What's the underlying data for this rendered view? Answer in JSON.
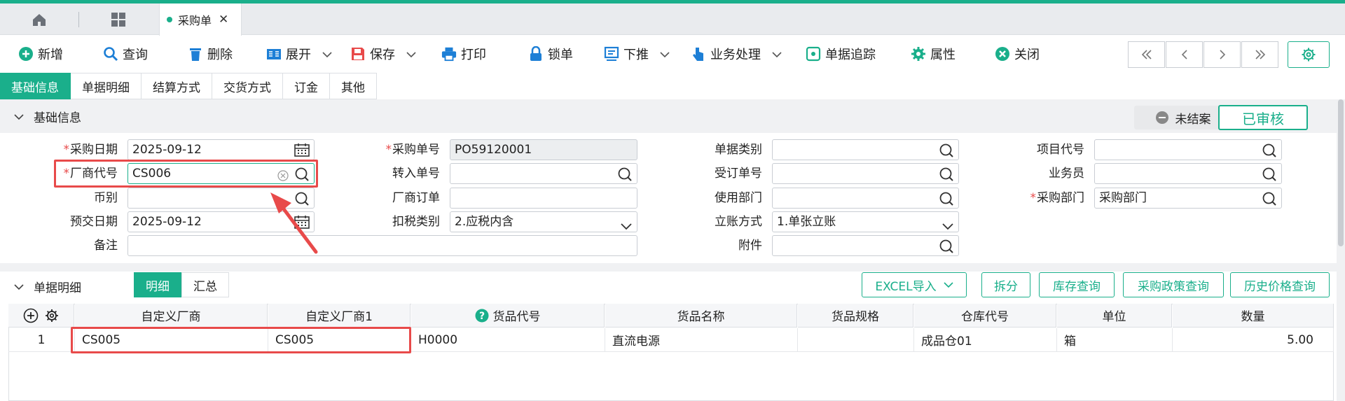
{
  "tabs": {
    "doc_tab_label": "采购单"
  },
  "toolbar": {
    "add": "新增",
    "query": "查询",
    "delete": "删除",
    "expand": "展开",
    "save": "保存",
    "print": "打印",
    "lock": "锁单",
    "push": "下推",
    "business": "业务处理",
    "trace": "单据追踪",
    "props": "属性",
    "close": "关闭"
  },
  "info_tabs": [
    "基础信息",
    "单据明细",
    "结算方式",
    "交货方式",
    "订金",
    "其他"
  ],
  "section_basic": {
    "title": "基础信息",
    "status": "未结案",
    "audit": "已审核"
  },
  "form": {
    "purchase_date": {
      "label": "采购日期",
      "value": "2025-09-12"
    },
    "vendor_code": {
      "label": "厂商代号",
      "value": "CS006"
    },
    "currency": {
      "label": "币别",
      "value": ""
    },
    "delivery_date": {
      "label": "预交日期",
      "value": "2025-09-12"
    },
    "remark": {
      "label": "备注",
      "value": ""
    },
    "po_no": {
      "label": "采购单号",
      "value": "PO59120001"
    },
    "transfer_no": {
      "label": "转入单号",
      "value": ""
    },
    "vendor_order": {
      "label": "厂商订单",
      "value": ""
    },
    "tax_type": {
      "label": "扣税类别",
      "value": "2.应税内含"
    },
    "doc_type": {
      "label": "单据类别",
      "value": ""
    },
    "order_no": {
      "label": "受订单号",
      "value": ""
    },
    "use_dept": {
      "label": "使用部门",
      "value": ""
    },
    "account_mode": {
      "label": "立账方式",
      "value": "1.单张立账"
    },
    "attachment": {
      "label": "附件",
      "value": ""
    },
    "project_code": {
      "label": "项目代号",
      "value": ""
    },
    "salesman": {
      "label": "业务员",
      "value": ""
    },
    "purchase_dept": {
      "label": "采购部门",
      "value": "采购部门"
    }
  },
  "section_detail": {
    "title": "单据明细",
    "seg_detail": "明细",
    "seg_summary": "汇总",
    "btn_excel": "EXCEL导入",
    "btn_split": "拆分",
    "btn_stock": "库存查询",
    "btn_policy": "采购政策查询",
    "btn_history": "历史价格查询"
  },
  "grid": {
    "columns": [
      "自定义厂商",
      "自定义厂商1",
      "货品代号",
      "货品名称",
      "货品规格",
      "仓库代号",
      "单位",
      "数量"
    ],
    "rows": [
      {
        "no": "1",
        "c1": "CS005",
        "c2": "CS005",
        "c3": "H0000",
        "c4": "直流电源",
        "c5": "",
        "c6": "成品仓01",
        "c7": "箱",
        "c8": "5.00"
      }
    ]
  },
  "colors": {
    "accent": "#1aaf8b",
    "highlight": "#e84a4a"
  },
  "icons": [
    "home-icon",
    "grid-icon",
    "plus-circle-icon",
    "search-icon",
    "trash-icon",
    "expand-icon",
    "save-icon",
    "print-icon",
    "lock-icon",
    "push-icon",
    "hand-icon",
    "trace-icon",
    "gear-icon",
    "close-circle-icon",
    "calendar-icon",
    "chevron-down-icon",
    "help-icon"
  ]
}
